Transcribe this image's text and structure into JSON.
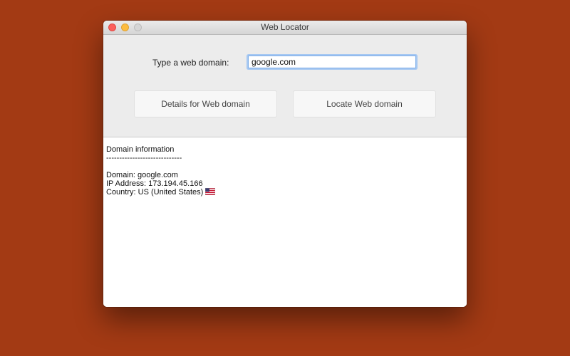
{
  "window": {
    "title": "Web Locator",
    "controls": {
      "close_icon": "close-traffic-light",
      "minimize_icon": "minimize-traffic-light",
      "zoom_icon": "zoom-traffic-light"
    }
  },
  "form": {
    "domain_label": "Type a web domain:",
    "domain_value": "google.com",
    "details_button": "Details for Web domain",
    "locate_button": "Locate Web domain"
  },
  "output": {
    "heading": "Domain information",
    "separator": "-----------------------------",
    "domain_line": "Domain: google.com",
    "ip_line": "IP Address: 173.194.45.166",
    "country_line": "Country: US (United States)",
    "country_flag_icon": "us-flag-icon"
  },
  "colors": {
    "desktop_background": "#a33a14",
    "close": "#fc605c",
    "minimize": "#fdbc40",
    "zoom_disabled": "#d6d6d6",
    "input_focus": "#7eaee8"
  }
}
